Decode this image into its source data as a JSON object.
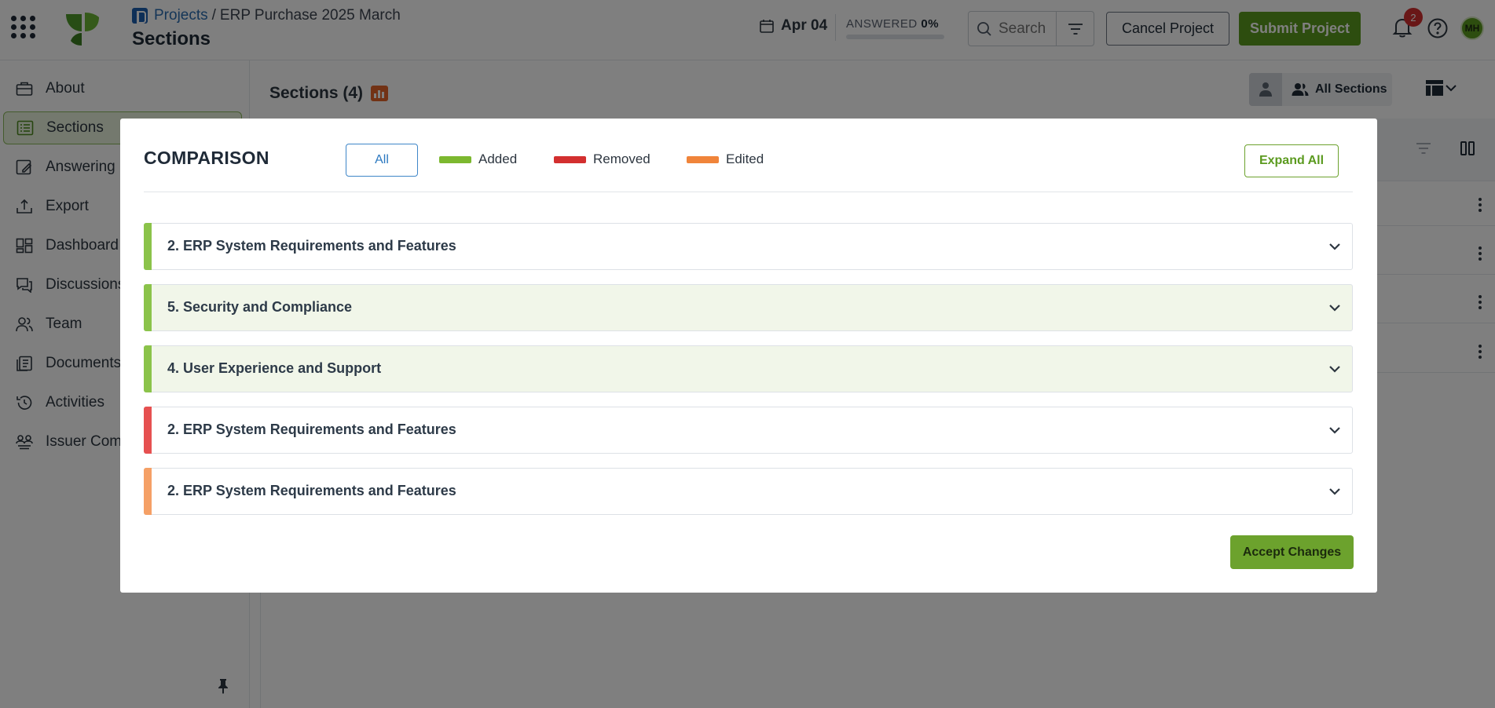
{
  "header": {
    "breadcrumb_root": "Projects",
    "breadcrumb_separator": "/",
    "breadcrumb_current": "ERP Purchase 2025 March",
    "page_title": "Sections",
    "date": "Apr 04",
    "answered_label": "ANSWERED",
    "answered_value": "0%",
    "answered_fraction": 0,
    "search_placeholder": "Search",
    "cancel_label": "Cancel Project",
    "submit_label": "Submit Project",
    "notification_count": "2",
    "avatar_initials": "MH"
  },
  "sidebar": {
    "items": [
      {
        "label": "About",
        "icon": "briefcase-icon"
      },
      {
        "label": "Sections",
        "icon": "list-icon",
        "active": true
      },
      {
        "label": "Answering F",
        "icon": "edit-note-icon"
      },
      {
        "label": "Export",
        "icon": "export-icon"
      },
      {
        "label": "Dashboard",
        "icon": "dashboard-icon"
      },
      {
        "label": "Discussions",
        "icon": "chat-icon"
      },
      {
        "label": "Team",
        "icon": "team-icon"
      },
      {
        "label": "Documents",
        "icon": "documents-icon"
      },
      {
        "label": "Activities",
        "icon": "history-icon"
      },
      {
        "label": "Issuer Comm",
        "icon": "issuer-icon"
      }
    ]
  },
  "main": {
    "title": "Sections (4)",
    "view_label": "All Sections"
  },
  "modal": {
    "title": "COMPARISON",
    "filter_all": "All",
    "legend": [
      {
        "label": "Added",
        "color": "#7cb82f"
      },
      {
        "label": "Removed",
        "color": "#d32f2f"
      },
      {
        "label": "Edited",
        "color": "#f0843a"
      }
    ],
    "expand_all": "Expand All",
    "sections": [
      {
        "label": "2. ERP System Requirements and Features",
        "status": "added",
        "color": "#8bc34a"
      },
      {
        "label": "5. Security and Compliance",
        "status": "added",
        "color": "#8bc34a"
      },
      {
        "label": "4. User Experience and Support",
        "status": "added",
        "color": "#8bc34a"
      },
      {
        "label": "2. ERP System Requirements and Features",
        "status": "removed",
        "color": "#e65050"
      },
      {
        "label": "2. ERP System Requirements and Features",
        "status": "edited",
        "color": "#f5a066"
      }
    ],
    "accept_label": "Accept Changes"
  }
}
